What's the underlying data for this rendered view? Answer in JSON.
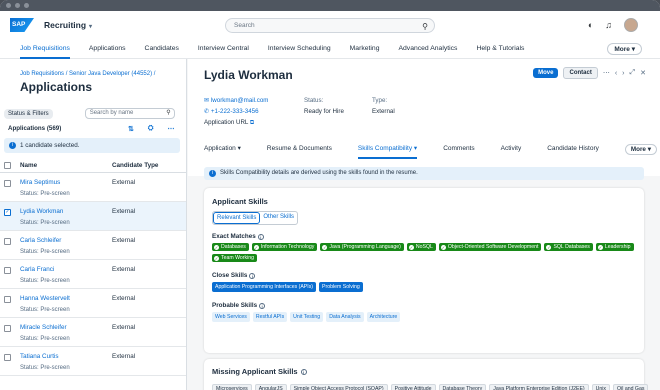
{
  "shell": {
    "logo": "SAP",
    "app": "Recruiting",
    "search_placeholder": "Search"
  },
  "nav": {
    "items": [
      "Job Requisitions",
      "Applications",
      "Candidates",
      "Interview Central",
      "Interview Scheduling",
      "Marketing",
      "Advanced Analytics",
      "Help & Tutorials"
    ],
    "more": "More"
  },
  "left": {
    "breadcrumb": "Job Requisitions / Senior Java Developer (44552) /",
    "title": "Applications",
    "filter_button": "Status & Filters",
    "sort_placeholder": "Search by name",
    "count": "Applications (569)",
    "selection_info": "1 candidate selected.",
    "col_name": "Name",
    "col_type": "Candidate Type",
    "rows": [
      {
        "name": "Mira Septimus",
        "status": "Status: Pre-screen",
        "type": "External",
        "selected": false
      },
      {
        "name": "Lydia Workman",
        "status": "Status: Pre-screen",
        "type": "External",
        "selected": true
      },
      {
        "name": "Carla Schleifer",
        "status": "Status: Pre-screen",
        "type": "External",
        "selected": false
      },
      {
        "name": "Carla Franci",
        "status": "Status: Pre-screen",
        "type": "External",
        "selected": false
      },
      {
        "name": "Hanna Westervelt",
        "status": "Status: Pre-screen",
        "type": "External",
        "selected": false
      },
      {
        "name": "Miracle Schleifer",
        "status": "Status: Pre-screen",
        "type": "External",
        "selected": false
      },
      {
        "name": "Tatiana Curtis",
        "status": "Status: Pre-screen",
        "type": "External",
        "selected": false
      }
    ]
  },
  "detail": {
    "name": "Lydia Workman",
    "move": "Move",
    "contact": "Contact",
    "email": "lworkman@mail.com",
    "phone": "+1-222-333-3456",
    "app_url": "Application URL",
    "status_label": "Status:",
    "status_value": "Ready for Hire",
    "type_label": "Type:",
    "type_value": "External",
    "tabs": [
      "Application",
      "Resume & Documents",
      "Skills Compatibility",
      "Comments",
      "Activity",
      "Candidate History"
    ],
    "tabs_more": "More",
    "banner": "Skills Compatibility details are derived using the skills found in the resume."
  },
  "skills": {
    "title": "Applicant Skills",
    "seg_relevant": "Relevant Skills",
    "seg_other": "Other Skills",
    "exact_label": "Exact Matches",
    "exact": [
      "Databases",
      "Information Technology",
      "Java (Programming Language)",
      "NoSQL",
      "Object-Oriented Software Development",
      "SQL Databases",
      "Leadership",
      "Team Working"
    ],
    "close_label": "Close Skills",
    "close": [
      "Application Programming Interfaces (APIs)",
      "Problem Solving"
    ],
    "probable_label": "Probable Skills",
    "probable": [
      "Web Services",
      "Restful APIs",
      "Unit Testing",
      "Data Analysis",
      "Architecture"
    ],
    "missing_title": "Missing Applicant Skills",
    "missing": [
      "Microservices",
      "AngularJS",
      "Simple Object Access Protocol (SOAP)",
      "Positive Attitude",
      "Database Theory",
      "Java Platform Enterprise Edition (J2EE)",
      "Unix",
      "Oil and Gas"
    ]
  },
  "colors": {
    "accent": "#0a6ed1",
    "match": "#188918"
  }
}
